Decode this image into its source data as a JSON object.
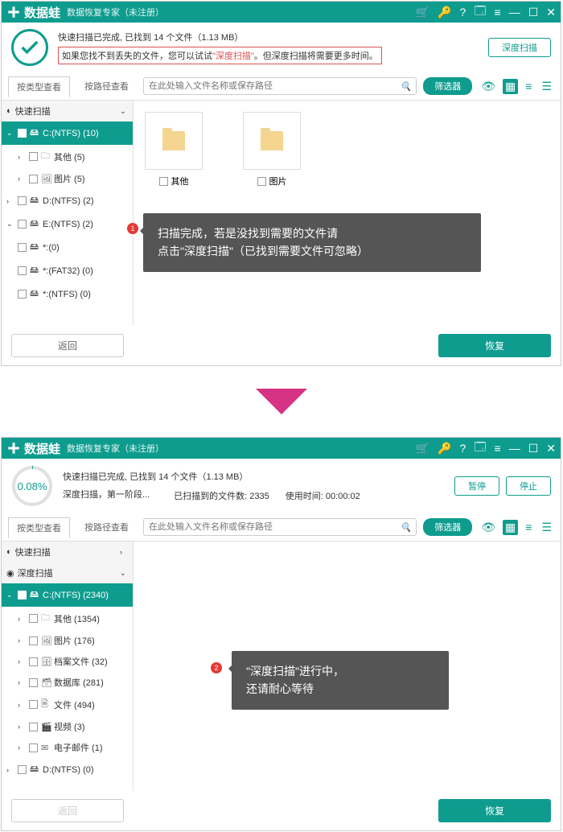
{
  "brand": "数据蛙",
  "subtitle": "数据恢复专家（未注册）",
  "titlebar_icons": [
    "cart",
    "key",
    "help",
    "save",
    "menu",
    "min",
    "max",
    "close"
  ],
  "win1": {
    "status_line1": "快速扫描已完成, 已找到 14 个文件（1.13 MB）",
    "status_line2a": "如果您找不到丢失的文件，您可以试试",
    "deep_link": "\"深度扫描\"",
    "status_line2b": "。但深度扫描将需要更多时间。",
    "deep_btn": "深度扫描",
    "tabs": {
      "byType": "按类型查看",
      "byPath": "按路径查看"
    },
    "search_placeholder": "在此处输入文件名称或保存路径",
    "filter_btn": "筛选器",
    "tree": {
      "quick": "快速扫描",
      "c_drive": "C:(NTFS) (10)",
      "c_other": "其他 (5)",
      "c_pic": "图片 (5)",
      "d_drive": "D:(NTFS) (2)",
      "e_drive": "E:(NTFS) (2)",
      "star0": "*:(0)",
      "star_fat": "*:(FAT32) (0)",
      "star_ntfs": "*:(NTFS) (0)"
    },
    "folders": {
      "other": "其他",
      "pic": "图片"
    },
    "tooltip": {
      "line1": "扫描完成，若是没找到需要的文件请",
      "line2": "点击\"深度扫描\"（已找到需要文件可忽略）",
      "num": "1"
    },
    "back_btn": "返回",
    "recover_btn": "恢复"
  },
  "win2": {
    "progress": "0.08%",
    "status_line1": "快速扫描已完成, 已找到 14 个文件（1.13 MB）",
    "status_line2": "深度扫描，第一阶段...",
    "scanned_label": "已扫描到的文件数:",
    "scanned_val": "2335",
    "time_label": "使用时间:",
    "time_val": "00:00:02",
    "pause_btn": "暂停",
    "stop_btn": "停止",
    "tabs": {
      "byType": "按类型查看",
      "byPath": "按路径查看"
    },
    "search_placeholder": "在此处输入文件名称或保存路径",
    "filter_btn": "筛选器",
    "tree": {
      "quick": "快速扫描",
      "deep": "深度扫描",
      "c_drive": "C:(NTFS) (2340)",
      "c_other": "其他 (1354)",
      "c_pic": "图片 (176)",
      "c_arch": "档案文件 (32)",
      "c_db": "数据库 (281)",
      "c_doc": "文件 (494)",
      "c_vid": "视频 (3)",
      "c_mail": "电子邮件 (1)",
      "d_drive": "D:(NTFS) (0)"
    },
    "tooltip": {
      "line1": "\"深度扫描\"进行中，",
      "line2": "还请耐心等待",
      "num": "2"
    },
    "back_btn": "返回",
    "recover_btn": "恢复"
  }
}
